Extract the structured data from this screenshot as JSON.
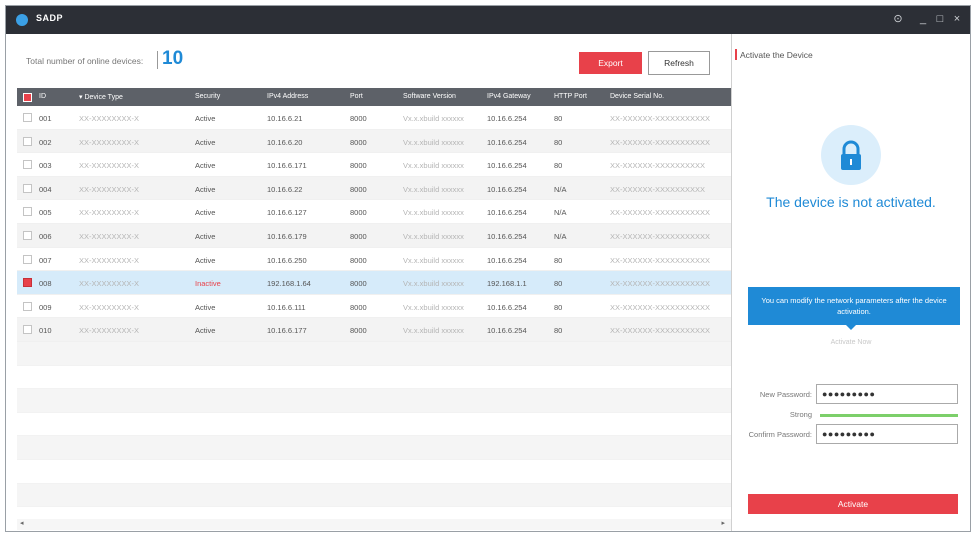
{
  "app": {
    "title": "SADP"
  },
  "window_controls": {
    "settings": "⊙",
    "minimize": "_",
    "maximize": "□",
    "close": "×"
  },
  "topbar": {
    "total_label": "Total number of online devices:",
    "total_count": "10",
    "export_label": "Export",
    "refresh_label": "Refresh"
  },
  "table": {
    "columns": [
      "ID",
      "Device Type",
      "Security",
      "IPv4 Address",
      "Port",
      "Software Version",
      "IPv4 Gateway",
      "HTTP Port",
      "Device Serial No."
    ],
    "rows": [
      {
        "id": "001",
        "type": "XX-XXXXXXXX-X",
        "security": "Active",
        "ipv4": "10.16.6.21",
        "port": "8000",
        "software": "Vx.x.xbuild xxxxxx",
        "gateway": "10.16.6.254",
        "http": "80",
        "serial": "XX-XXXXXX-XXXXXXXXXXX",
        "checked": false
      },
      {
        "id": "002",
        "type": "XX-XXXXXXXX-X",
        "security": "Active",
        "ipv4": "10.16.6.20",
        "port": "8000",
        "software": "Vx.x.xbuild xxxxxx",
        "gateway": "10.16.6.254",
        "http": "80",
        "serial": "XX-XXXXXX-XXXXXXXXXXX",
        "checked": false
      },
      {
        "id": "003",
        "type": "XX-XXXXXXXX-X",
        "security": "Active",
        "ipv4": "10.16.6.171",
        "port": "8000",
        "software": "Vx.x.xbuild xxxxxx",
        "gateway": "10.16.6.254",
        "http": "80",
        "serial": "XX-XXXXXX-XXXXXXXXXX",
        "checked": false
      },
      {
        "id": "004",
        "type": "XX-XXXXXXXX-X",
        "security": "Active",
        "ipv4": "10.16.6.22",
        "port": "8000",
        "software": "Vx.x.xbuild xxxxxx",
        "gateway": "10.16.6.254",
        "http": "N/A",
        "serial": "XX-XXXXXX-XXXXXXXXXX",
        "checked": false
      },
      {
        "id": "005",
        "type": "XX-XXXXXXXX-X",
        "security": "Active",
        "ipv4": "10.16.6.127",
        "port": "8000",
        "software": "Vx.x.xbuild xxxxxx",
        "gateway": "10.16.6.254",
        "http": "N/A",
        "serial": "XX-XXXXXX-XXXXXXXXXXX",
        "checked": false
      },
      {
        "id": "006",
        "type": "XX-XXXXXXXX-X",
        "security": "Active",
        "ipv4": "10.16.6.179",
        "port": "8000",
        "software": "Vx.x.xbuild xxxxxx",
        "gateway": "10.16.6.254",
        "http": "N/A",
        "serial": "XX-XXXXXX-XXXXXXXXXXX",
        "checked": false
      },
      {
        "id": "007",
        "type": "XX-XXXXXXXX-X",
        "security": "Active",
        "ipv4": "10.16.6.250",
        "port": "8000",
        "software": "Vx.x.xbuild xxxxxx",
        "gateway": "10.16.6.254",
        "http": "80",
        "serial": "XX-XXXXXX-XXXXXXXXXXX",
        "checked": false
      },
      {
        "id": "008",
        "type": "XX-XXXXXXXX-X",
        "security": "Inactive",
        "ipv4": "192.168.1.64",
        "port": "8000",
        "software": "Vx.x.xbuild xxxxxx",
        "gateway": "192.168.1.1",
        "http": "80",
        "serial": "XX-XXXXXX-XXXXXXXXXXX",
        "checked": true
      },
      {
        "id": "009",
        "type": "XX-XXXXXXXX-X",
        "security": "Active",
        "ipv4": "10.16.6.111",
        "port": "8000",
        "software": "Vx.x.xbuild xxxxxx",
        "gateway": "10.16.6.254",
        "http": "80",
        "serial": "XX-XXXXXX-XXXXXXXXXXX",
        "checked": false
      },
      {
        "id": "010",
        "type": "XX-XXXXXXXX-X",
        "security": "Active",
        "ipv4": "10.16.6.177",
        "port": "8000",
        "software": "Vx.x.xbuild xxxxxx",
        "gateway": "10.16.6.254",
        "http": "80",
        "serial": "XX-XXXXXX-XXXXXXXXXXX",
        "checked": false
      }
    ]
  },
  "panel": {
    "title": "Activate the Device",
    "not_activated": "The device is not activated.",
    "tooltip": "You can modify the network parameters after the device activation.",
    "activate_now": "Activate Now",
    "new_password_label": "New Password:",
    "new_password_value": "●●●●●●●●●",
    "strength_label": "Strong",
    "strength_level": 1.0,
    "confirm_password_label": "Confirm Password:",
    "confirm_password_value": "●●●●●●●●●",
    "activate_label": "Activate"
  },
  "colors": {
    "accent_blue": "#1f8ad6",
    "accent_red": "#e8414a",
    "titlebar": "#2c2f36",
    "header": "#5d6168"
  }
}
